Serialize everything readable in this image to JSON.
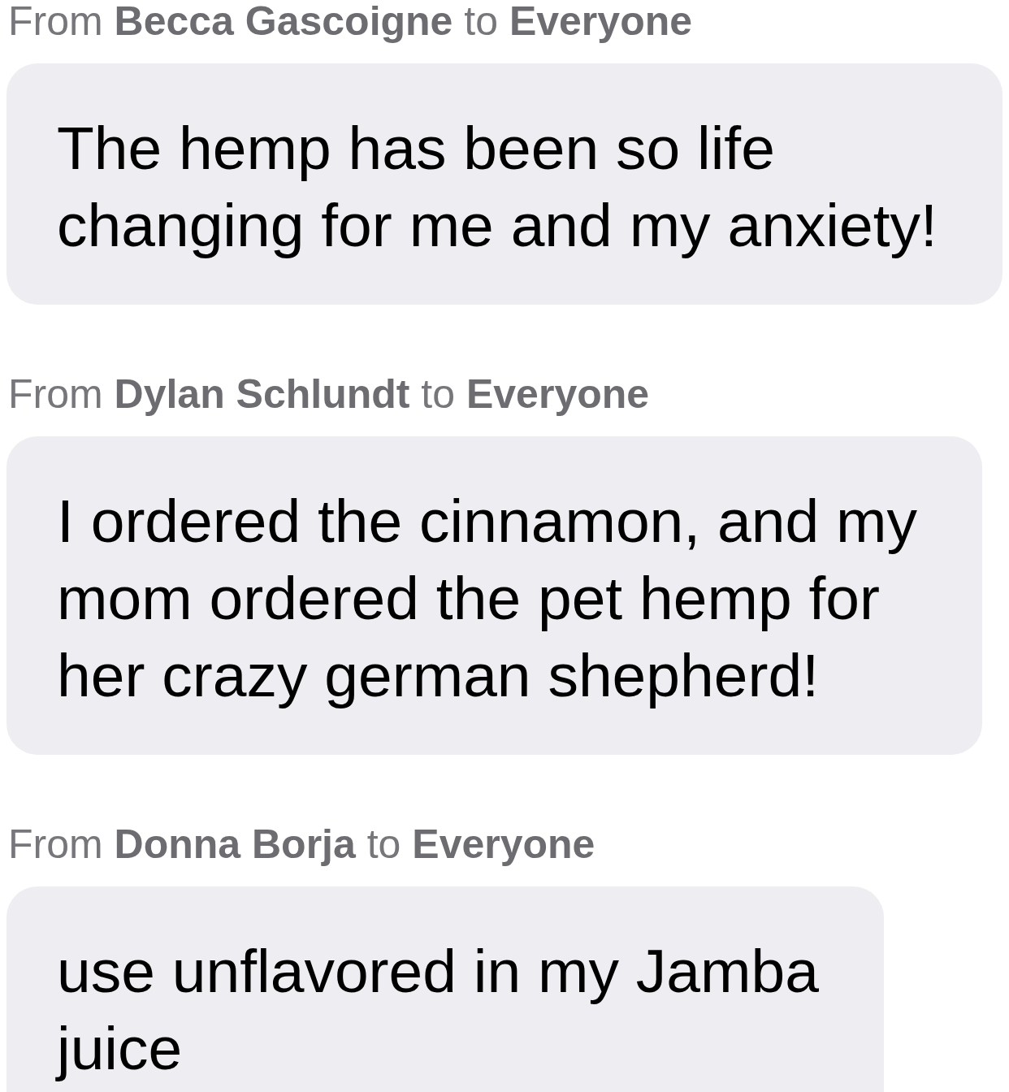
{
  "messages": [
    {
      "header": "From **Becca Gascoigne** to **Everyone**",
      "text": "The hemp has been so life changing for me and my anxiety!"
    },
    {
      "header": "From **Dylan Schlundt** to **Everyone**",
      "text": "I ordered the cinnamon, and my mom ordered the pet hemp for her crazy german shepherd!"
    },
    {
      "header": "From **Donna Borja** to **Everyone**",
      "text": "use unflavored in my Jamba juice"
    }
  ]
}
